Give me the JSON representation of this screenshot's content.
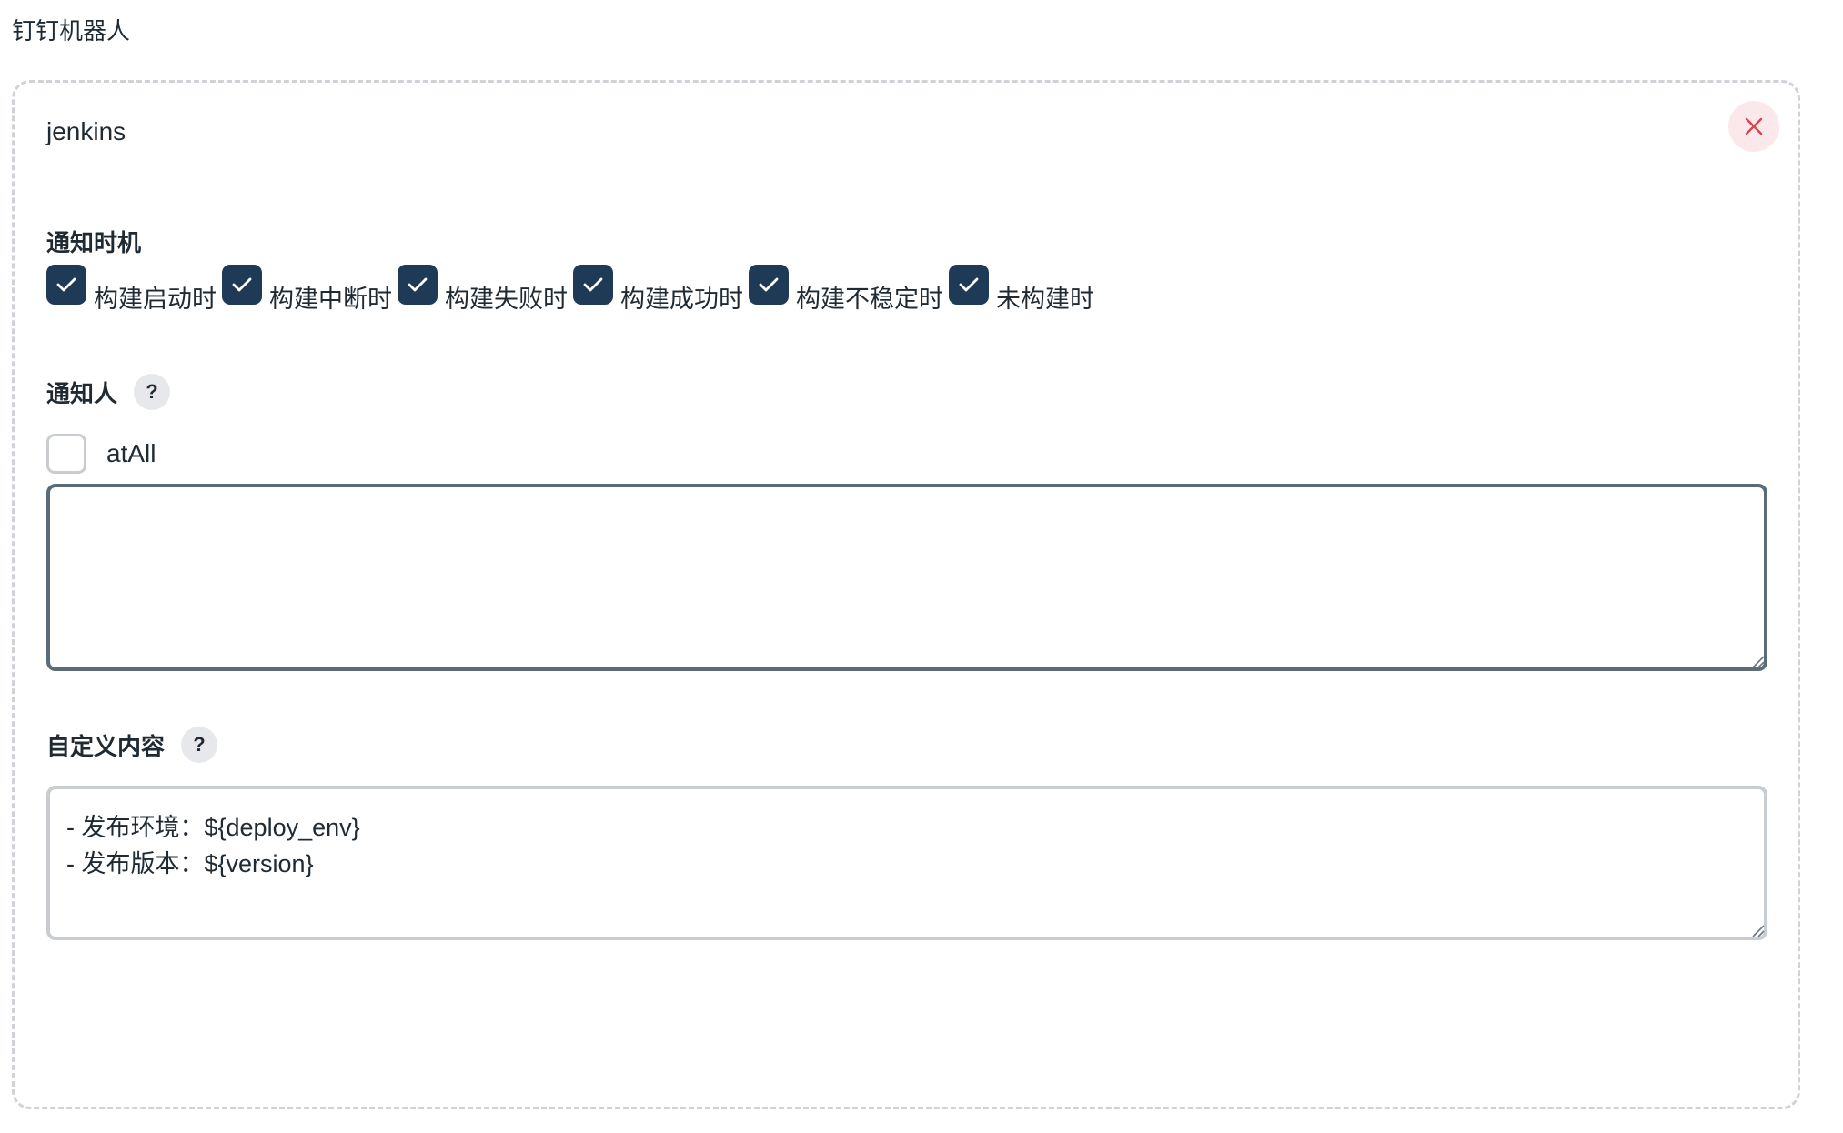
{
  "page": {
    "title": "钉钉机器人"
  },
  "robot": {
    "name": "jenkins",
    "close_icon": "close-icon",
    "notify_timing": {
      "label": "通知时机",
      "options": [
        {
          "label": "构建启动时",
          "checked": true
        },
        {
          "label": "构建中断时",
          "checked": true
        },
        {
          "label": "构建失败时",
          "checked": true
        },
        {
          "label": "构建成功时",
          "checked": true
        },
        {
          "label": "构建不稳定时",
          "checked": true
        },
        {
          "label": "未构建时",
          "checked": true
        }
      ]
    },
    "notify_people": {
      "label": "通知人",
      "help": "?",
      "at_all_label": "atAll",
      "at_all_checked": false,
      "input_value": ""
    },
    "custom_content": {
      "label": "自定义内容",
      "help": "?",
      "value": "- 发布环境：${deploy_env}\n- 发布版本：${version}"
    }
  },
  "colors": {
    "checkbox_checked": "#1f3a57",
    "close_bg": "#fbe8ea",
    "close_icon": "#d64550"
  }
}
